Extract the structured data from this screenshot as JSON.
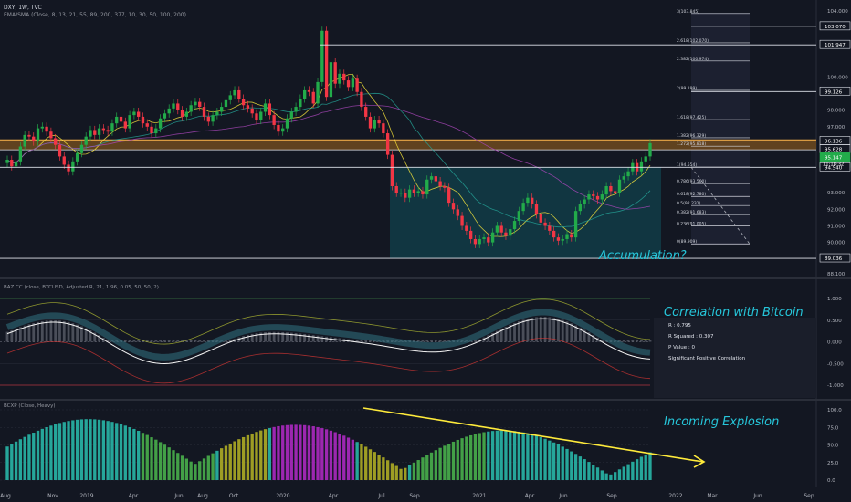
{
  "header": {
    "symbol_line": "DXY, 1W, TVC",
    "ma_line": "EMA/SMA (Close, 8, 13, 21, 55, 89, 200, 377, 10, 30, 50, 100, 200)"
  },
  "panes": {
    "cc_legend": "BAZ CC (close, BTCUSD, Adjusted R, 21, 1.96, 0.05, 50, 50, 2)",
    "bcxp_legend": "BCXP (Close, Heavy)"
  },
  "annotations": {
    "accumulation": "Accumulation?",
    "correlation_title": "Correlation with Bitcoin",
    "incoming": "Incoming Explosion"
  },
  "stats": {
    "r": "R : 0.795",
    "r2": "R Squared : 0.307",
    "p": "P Value : 0",
    "sig": "Significant Positive Correlation"
  },
  "colors": {
    "bg": "#131722",
    "up": "#22ab4a",
    "down": "#f23645",
    "band_fill": "#6e4a1f",
    "band_line": "#ffb74d",
    "accum_fill": "#123a45",
    "text_cyan": "#26c6da",
    "trend_yellow": "#ffeb3b",
    "purple": "#9c27b0",
    "olive": "#9e9d24",
    "green_bar": "#43a047",
    "teal_bar": "#26a69a"
  },
  "chart_data": [
    {
      "type": "candlestick",
      "x_ticks": [
        "Aug",
        "Nov",
        "2019",
        "Apr",
        "Jun",
        "Aug",
        "Oct",
        "2020",
        "Apr",
        "Jul",
        "Sep",
        "2021",
        "Apr",
        "Jun",
        "Sep",
        "2022",
        "Mar",
        "Jun",
        "Sep"
      ],
      "y_ticks": [
        "104.000",
        "102.000",
        "100.000",
        "98.000",
        "97.000",
        "96.000",
        "93.000",
        "92.000",
        "91.000",
        "90.000",
        "88.100"
      ],
      "price_labels": [
        "103.070",
        "101.947",
        "99.126",
        "96.136",
        "95.628",
        "95.147",
        "94.540",
        "89.036"
      ],
      "current_time": "11:18:32",
      "fib_levels": [
        "3(103.845)",
        "2.618(102.070)",
        "2.382(100.974)",
        "2(99.199)",
        "1.618(97.425)",
        "1.382(96.329)",
        "1.272(95.818)",
        "1(94.554)",
        "0.786(93.560)",
        "0.618(92.780)",
        "0.5(92.231)",
        "0.382(91.683)",
        "0.236(91.005)",
        "0(89.909)"
      ],
      "close": [
        95.0,
        94.6,
        94.9,
        95.8,
        96.5,
        96.4,
        96.1,
        96.9,
        97.0,
        96.7,
        96.3,
        95.9,
        95.2,
        94.7,
        94.3,
        94.9,
        95.4,
        95.9,
        96.4,
        96.8,
        96.5,
        96.9,
        96.8,
        96.7,
        97.2,
        97.6,
        97.3,
        96.9,
        97.7,
        97.9,
        97.6,
        97.2,
        97.0,
        96.6,
        96.9,
        97.5,
        97.8,
        98.1,
        98.4,
        98.0,
        97.6,
        97.9,
        98.3,
        98.5,
        98.2,
        97.6,
        97.3,
        97.7,
        97.9,
        98.2,
        98.6,
        98.9,
        99.2,
        98.7,
        98.3,
        98.1,
        97.8,
        97.4,
        97.9,
        98.4,
        97.7,
        97.1,
        96.7,
        96.9,
        97.5,
        97.9,
        98.2,
        98.7,
        99.2,
        99.1,
        98.4,
        99.7,
        102.8,
        98.8,
        100.9,
        99.6,
        100.2,
        99.8,
        99.4,
        99.9,
        99.1,
        98.2,
        97.6,
        96.9,
        97.4,
        97.2,
        96.6,
        95.3,
        93.4,
        93.0,
        93.0,
        92.7,
        93.2,
        93.0,
        93.1,
        92.9,
        93.8,
        94.0,
        93.7,
        93.4,
        93.3,
        92.4,
        92.0,
        91.6,
        91.0,
        90.7,
        90.2,
        89.9,
        90.2,
        90.3,
        90.0,
        90.6,
        91.0,
        90.6,
        90.4,
        90.8,
        91.3,
        91.9,
        92.4,
        92.7,
        92.3,
        91.7,
        91.2,
        91.0,
        90.7,
        90.3,
        90.1,
        90.2,
        90.5,
        90.3,
        91.9,
        92.3,
        92.6,
        92.9,
        92.8,
        92.6,
        92.9,
        93.4,
        93.1,
        93.0,
        93.8,
        94.0,
        94.3,
        94.8,
        94.3,
        94.9,
        95.2,
        96.0
      ]
    },
    {
      "type": "line",
      "title": "BAZ CC",
      "y_ticks": [
        "1.000",
        "0.500",
        "0.000",
        "-0.500",
        "-1.000"
      ]
    },
    {
      "type": "bar",
      "title": "BCXP",
      "y_ticks": [
        "100.0",
        "75.0",
        "50.0",
        "25.0",
        "0.0"
      ]
    }
  ]
}
